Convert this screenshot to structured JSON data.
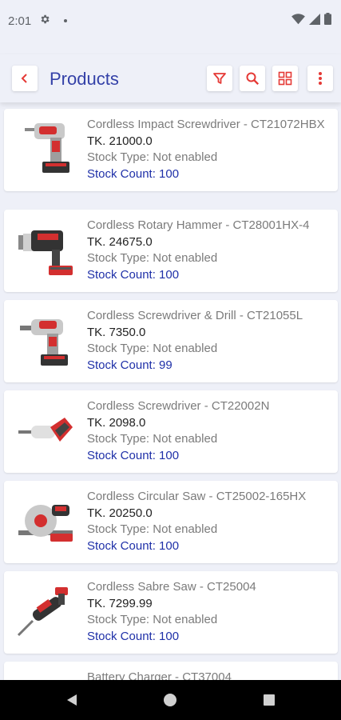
{
  "status_bar": {
    "time": "2:01"
  },
  "header": {
    "title": "Products"
  },
  "products": [
    {
      "name": "Cordless Impact Screwdriver - CT21072HBX",
      "price": "TK. 21000.0",
      "stock_type": "Stock Type: Not enabled",
      "stock_count": "Stock Count: 100"
    },
    {
      "name": "Cordless Rotary Hammer - CT28001HX-4",
      "price": "TK. 24675.0",
      "stock_type": "Stock Type: Not enabled",
      "stock_count": "Stock Count: 100"
    },
    {
      "name": "Cordless Screwdriver & Drill - CT21055L",
      "price": "TK. 7350.0",
      "stock_type": "Stock Type: Not enabled",
      "stock_count": "Stock Count: 99"
    },
    {
      "name": "Cordless Screwdriver - CT22002N",
      "price": "TK. 2098.0",
      "stock_type": "Stock Type: Not enabled",
      "stock_count": "Stock Count: 100"
    },
    {
      "name": "Cordless Circular Saw - CT25002-165HX",
      "price": "TK. 20250.0",
      "stock_type": "Stock Type: Not enabled",
      "stock_count": "Stock Count: 100"
    },
    {
      "name": "Cordless Sabre Saw - CT25004",
      "price": "TK. 7299.99",
      "stock_type": "Stock Type: Not enabled",
      "stock_count": "Stock Count: 100"
    },
    {
      "name": "Battery Charger - CT37004",
      "price": "",
      "stock_type": "",
      "stock_count": ""
    }
  ],
  "colors": {
    "accent": "#3441a8",
    "icon_red": "#e53935",
    "count_blue": "#1f30a8"
  }
}
